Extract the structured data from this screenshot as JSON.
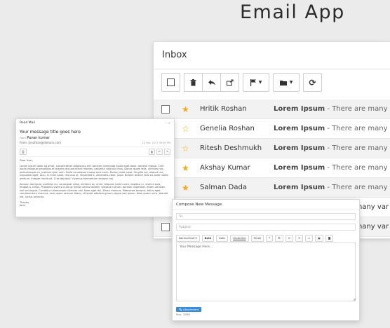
{
  "app_title": "Email App",
  "inbox": {
    "title": "Inbox",
    "toolbar": {
      "icons": [
        "checkbox-icon",
        "trash-icon",
        "reply-icon",
        "forward-icon",
        "flag-icon",
        "folder-icon",
        "refresh-icon"
      ]
    },
    "rows": [
      {
        "starred": true,
        "sender": "Hritik Roshan",
        "subject": "Lorem Ipsum",
        "preview": " - There are many var"
      },
      {
        "starred": false,
        "sender": "Genelia Roshan",
        "subject": "Lorem Ipsum",
        "preview": " - There are many var"
      },
      {
        "starred": false,
        "sender": "Ritesh Deshmukh",
        "subject": "Lorem Ipsum",
        "preview": " - There are many var"
      },
      {
        "starred": true,
        "sender": "Akshay Kumar",
        "subject": "Lorem Ipsum",
        "preview": " - There are many var"
      },
      {
        "starred": true,
        "sender": "Salman Dada",
        "subject": "Lorem Ipsum",
        "preview": " - There are many var"
      },
      {
        "starred": false,
        "sender": "",
        "subject": "",
        "preview": "nany var"
      },
      {
        "starred": false,
        "sender": "",
        "subject": "",
        "preview": "nany var"
      }
    ]
  },
  "read_mail": {
    "header": "Read Mail",
    "subject": "Your message title goes here",
    "from_label": "From",
    "from_name": "Pavan kumar",
    "from_email": "From: jonathan@domain.com",
    "date": "15 Feb. 2017 09:00 PM",
    "greeting": "Dear User,",
    "paragraph1": "Lorem ipsum dolor sit amet, consectetuer adipiscing elit. Aenean commodo ligula eget dolor. Aenean massa. Cum sociis natoque penatibus et magnis dis parturient montes, nascetur ridiculus mus. Donec quam felis, ultricies nec, pellentesque eu, pretium quis, sem. Nulla consequat massa quis enim. Donec pede justo, fringilla vel, aliquet nec, vulputate eget, arcu. In enim justo, rhoncus ut, imperdiet a, venenatis vitae, justo. Nullam dictum felis eu pede mollis pretium. Integer tincidunt. Cras dapibus. Vivamus elementum semper nisi.",
    "paragraph2": "Aenean leo ligula, porttitor eu, consequat vitae, eleifend ac, enim. Aliquam lorem ante, dapibus in, viverra quis, feugiat a, tellus. Phasellus viverra nulla ut metus varius laoreet. Quisque rutrum. Aenean imperdiet. Etiam ultricies nisi vel augue. Curabitur ullamcorper ultricies nisi. Nam eget dui. Etiam rhoncus. Maecenas tempus, tellus eget condimentum rhoncus, sem quam semper libero, sit amet adipiscing sem neque sed ipsum. Nam quam nunc, blandit vel, luctus pulvinar.",
    "signoff": "Thanks,",
    "signature": "Jane"
  },
  "compose": {
    "title": "Compose New Message",
    "to_placeholder": "To:",
    "subject_placeholder": "Subject:",
    "toolbar": [
      "Normal text",
      "Bold",
      "Italic",
      "Underline",
      "Small"
    ],
    "editor_placeholder": "Your Message Here....",
    "attach_label": "Attachment",
    "max_label": "Max. 32MB"
  },
  "colors": {
    "star": "#f0a825",
    "attach_button": "#3a8bd6",
    "selected_row": "#f2f2f2"
  }
}
